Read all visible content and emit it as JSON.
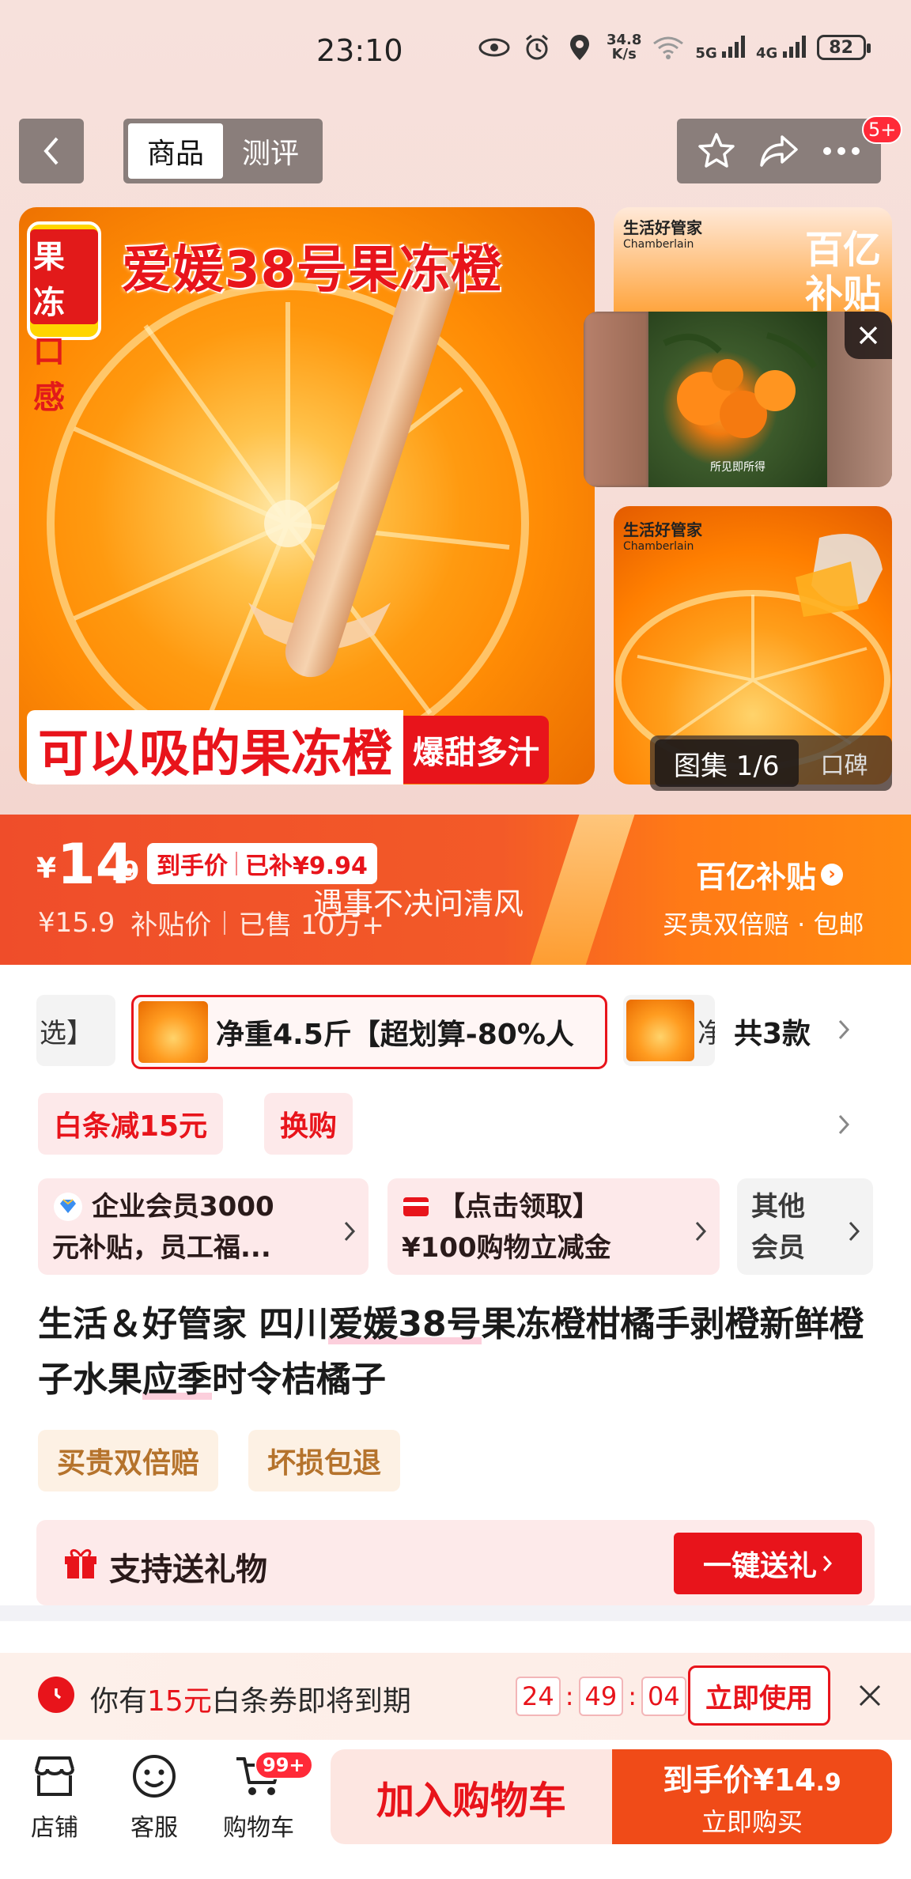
{
  "status_bar": {
    "time": "23:10",
    "net_speed_value": "34.8",
    "net_speed_unit": "K/s",
    "signal_1": "5G",
    "signal_2": "4G",
    "battery": "82"
  },
  "nav": {
    "tabs": [
      {
        "label": "商品",
        "active": true
      },
      {
        "label": "测评",
        "active": false
      }
    ],
    "more_badge": "5+"
  },
  "gallery": {
    "main_tag_line1": "果冻",
    "main_tag_line2": "口感",
    "main_title": "爱媛38号果冻橙",
    "main_slogan_left": "可以吸的果冻橙",
    "main_slogan_right": "爆甜多汁",
    "brand_cn": "生活好管家",
    "brand_en": "Chamberlain",
    "subsidy_line1": "百亿",
    "subsidy_line2": "补贴",
    "video_caption": "所见即所得",
    "counter_active": "图集 1/6",
    "counter_other": "口碑"
  },
  "price_banner": {
    "currency": "¥",
    "price_int": "14",
    "price_dec": ".9",
    "tag_label": "到手价",
    "tag_subsidy": "已补¥9.94",
    "original_price": "¥15.9",
    "original_label": "补贴价",
    "sold": "已售 10万+",
    "watermark": "遇事不决问清风",
    "logo_text": "百亿补贴",
    "right_sub": "买贵双倍赔 · 包邮",
    "colors": {
      "start": "#ef4d2a",
      "end": "#ff8a10"
    }
  },
  "variants": {
    "prev_label": "选】",
    "selected_label": "净重4.5斤【超划算-80%人",
    "next_label": "净",
    "count_label": "共3款"
  },
  "promos": {
    "tag1": "白条减15元",
    "tag2": "换购"
  },
  "members": {
    "card1_line1": "企业会员3000",
    "card1_line2": "元补贴，员工福...",
    "card2_line1": "【点击领取】",
    "card2_line2": "¥100购物立减金",
    "other_line1": "其他",
    "other_line2": "会员"
  },
  "product": {
    "title_part1": "生活＆好管家 四川",
    "title_hl1": "爱媛38号",
    "title_part2": "果冻橙柑橘手剥橙新鲜橙子水果",
    "title_hl2": "应季",
    "title_part3": "时令桔橘子"
  },
  "services": [
    "买贵双倍赔",
    "坏损包退"
  ],
  "gift": {
    "label": "支持送礼物",
    "button": "一键送礼"
  },
  "coupon": {
    "text_before": "你有",
    "amount": "15元",
    "text_after": "白条券即将到期",
    "hours": "24",
    "minutes": "49",
    "seconds": "04",
    "button": "立即使用"
  },
  "bottom_bar": {
    "shop": "店铺",
    "service": "客服",
    "cart": "购物车",
    "cart_badge": "99+",
    "add_cart": "加入购物车",
    "buy_price_label": "到手价¥14",
    "buy_price_dec": ".9",
    "buy_now": "立即购买"
  }
}
